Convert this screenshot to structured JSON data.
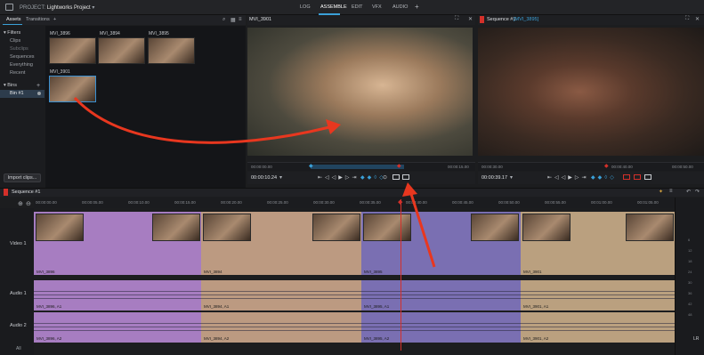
{
  "topbar": {
    "project_prefix": "PROJECT:",
    "project_name": "Lightworks Project",
    "nav": [
      "LOG",
      "ASSEMBLE",
      "EDIT",
      "VFX",
      "AUDIO"
    ],
    "active_nav": "ASSEMBLE",
    "add_label": "+"
  },
  "assets": {
    "tabs": [
      "Assets",
      "Transitions"
    ],
    "add_tab": "+",
    "filters_header": "Filters",
    "filters": [
      "Clips",
      "Subclips",
      "Sequences",
      "Everything",
      "Recent"
    ],
    "bins_header": "Bins",
    "bins": [
      "Bin #1"
    ],
    "import_button": "Import clips...",
    "thumbnails": [
      "MVI_3896",
      "MVI_3894",
      "MVI_3895",
      "MVI_3901"
    ]
  },
  "source_viewer": {
    "title": "MVI_3901",
    "ruler_ticks": [
      "00:00:00.00",
      "00:00:05.00",
      "00:00:10.00",
      "00:00:15.00"
    ],
    "timecode": "00:00:10.24"
  },
  "record_viewer": {
    "title": "Sequence #1",
    "subtitle": "[MVI_3895]",
    "ruler_ticks": [
      "00:00:30.00",
      "00:00:40.00",
      "00:00:50.00"
    ],
    "timecode": "00:00:39.17"
  },
  "timeline": {
    "title": "Sequence #1",
    "ruler_ticks": [
      "00:00:00.00",
      "00:00:05.00",
      "00:00:10.00",
      "00:00:15.00",
      "00:00:20.00",
      "00:00:25.00",
      "00:00:30.00",
      "00:00:35.00",
      "00:00:40.00",
      "00:00:45.00",
      "00:00:50.00",
      "00:00:55.00",
      "00:01:00.00",
      "00:01:05.00"
    ],
    "tracks": [
      "Video 1",
      "Audio 1",
      "Audio 2"
    ],
    "all_label": "All",
    "lr_label": "LR",
    "video_clips": [
      {
        "name": "MVI_3896",
        "color": "#a77dc1"
      },
      {
        "name": "MVI_3894",
        "color": "#bc9a81"
      },
      {
        "name": "MVI_3895",
        "color": "#7a6fb2"
      },
      {
        "name": "MVI_3901",
        "color": "#baa07f"
      }
    ],
    "audio1_clips": [
      "MVI_3896, A1",
      "MVI_3894, A1",
      "MVI_3895, A1",
      "MVI_3901, A1"
    ],
    "audio2_clips": [
      "MVI_3896, A2",
      "MVI_3894, A2",
      "MVI_3895, A2",
      "MVI_3901, A2"
    ],
    "right_strip_numbers": [
      "6",
      "12",
      "18",
      "24",
      "30",
      "36",
      "42",
      "48"
    ]
  },
  "colors": {
    "accent": "#3aa0d8",
    "playhead": "#d4302a",
    "annotation_arrow": "#e8371f"
  }
}
